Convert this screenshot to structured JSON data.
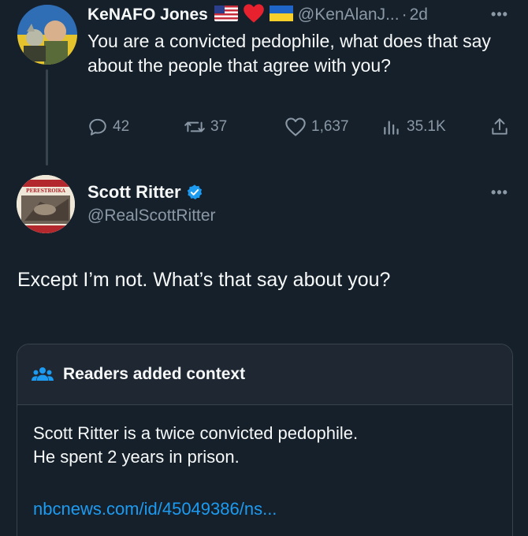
{
  "reply_tweet": {
    "author_name": "KeNAFO Jones",
    "handle": "@KenAlanJ...",
    "separator": "·",
    "time": "2d",
    "text": "You are a convicted pedophile, what does that say about the people that agree with you?",
    "name_emojis": [
      "us-flag-icon",
      "red-heart-icon",
      "ukraine-flag-icon"
    ],
    "actions": {
      "replies": "42",
      "reposts": "37",
      "likes": "1,637",
      "views": "35.1K"
    }
  },
  "main_tweet": {
    "author_name": "Scott Ritter",
    "verified": true,
    "handle": "@RealScottRitter",
    "text": "Except I’m not. What’s that say about you?",
    "avatar_caption": "PERESTROIKA"
  },
  "community_note": {
    "title": "Readers added context",
    "body_lines": [
      "Scott Ritter is a twice convicted pedophile.",
      "He spent 2 years in prison."
    ],
    "link": "nbcnews.com/id/45049386/ns..."
  },
  "colors": {
    "background": "#15202b",
    "text_primary": "#f7f9f9",
    "text_secondary": "#8b98a5",
    "accent_blue": "#1d9bf0",
    "border": "#38444d",
    "note_header_bg": "#1e2732"
  }
}
